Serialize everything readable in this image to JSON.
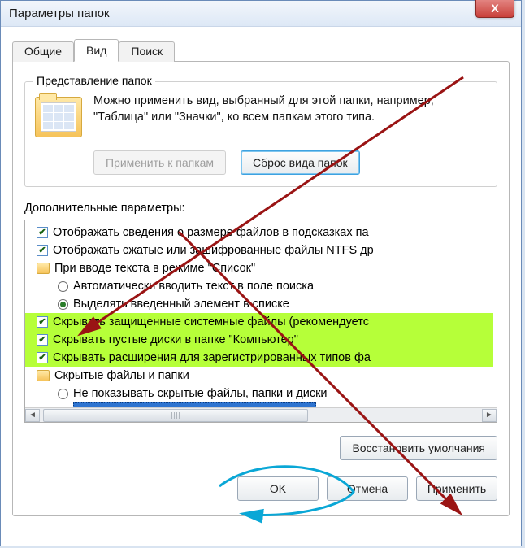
{
  "window": {
    "title": "Параметры папок",
    "close_glyph": "X"
  },
  "tabs": {
    "general": "Общие",
    "view": "Вид",
    "search": "Поиск"
  },
  "group": {
    "legend": "Представление папок",
    "desc": "Можно применить вид, выбранный для этой папки, например, \"Таблица\" или \"Значки\", ко всем папкам этого типа.",
    "apply_btn": "Применить к папкам",
    "reset_btn": "Сброс вида папок"
  },
  "adv": {
    "label": "Дополнительные параметры:",
    "items": {
      "i0": "Отображать сведения о размере файлов в подсказках па",
      "i1": "Отображать сжатые или зашифрованные файлы NTFS др",
      "i2": "При вводе текста в режиме \"Список\"",
      "i2a": "Автоматически вводить текст в поле поиска",
      "i2b": "Выделять введенный элемент в списке",
      "i3": "Скрывать защищенные системные файлы (рекомендуетс",
      "i4": "Скрывать пустые диски в папке \"Компьютер\"",
      "i5": "Скрывать расширения для зарегистрированных типов фа",
      "i6": "Скрытые файлы и папки",
      "i6a": "Не показывать скрытые файлы, папки и диски",
      "i6b": "Показывать скрытые файлы, папки и диски"
    }
  },
  "restore_btn": "Восстановить умолчания",
  "buttons": {
    "ok": "OK",
    "cancel": "Отмена",
    "apply": "Применить"
  }
}
